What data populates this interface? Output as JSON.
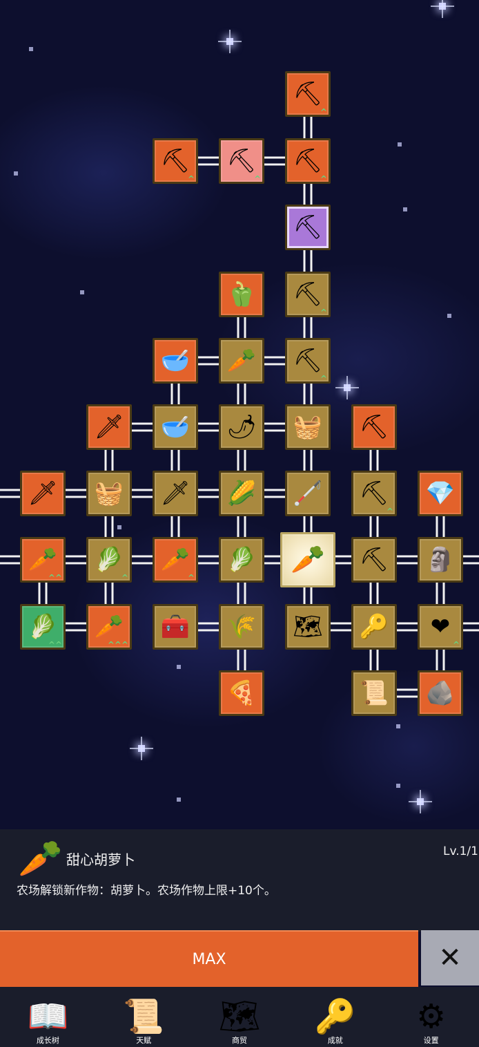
{
  "tree": {
    "nodes": [
      {
        "id": "n1",
        "color": "orange",
        "icon": "shovel-icon",
        "glyph": "⛏",
        "level_mark": "^",
        "col": 4,
        "row": 0
      },
      {
        "id": "n2",
        "color": "orange",
        "icon": "shovel-icon",
        "glyph": "⛏",
        "level_mark": "^",
        "col": 2,
        "row": 1
      },
      {
        "id": "n3",
        "color": "pink",
        "icon": "shovel-icon",
        "glyph": "⛏",
        "level_mark": "^",
        "col": 3,
        "row": 1
      },
      {
        "id": "n4",
        "color": "orange",
        "icon": "shovel-icon",
        "glyph": "⛏",
        "level_mark": "^",
        "col": 4,
        "row": 1
      },
      {
        "id": "n5",
        "color": "purple",
        "icon": "shovel-icon",
        "glyph": "⛏",
        "level_mark": "",
        "col": 4,
        "row": 2
      },
      {
        "id": "n6",
        "color": "orange",
        "icon": "pepper-icon",
        "glyph": "🫑",
        "level_mark": "",
        "col": 3,
        "row": 3
      },
      {
        "id": "n7",
        "color": "olive",
        "icon": "shovel-icon",
        "glyph": "⛏",
        "level_mark": "^",
        "col": 4,
        "row": 3
      },
      {
        "id": "n8",
        "color": "orange",
        "icon": "soup-bowl-icon",
        "glyph": "🥣",
        "level_mark": "",
        "col": 2,
        "row": 4
      },
      {
        "id": "n9",
        "color": "olive",
        "icon": "radish-icon",
        "glyph": "🥕",
        "level_mark": "",
        "col": 3,
        "row": 4
      },
      {
        "id": "n10",
        "color": "olive",
        "icon": "shovel-icon",
        "glyph": "⛏",
        "level_mark": "^",
        "col": 4,
        "row": 4
      },
      {
        "id": "n11",
        "color": "orange",
        "icon": "golden-sword-icon",
        "glyph": "🗡",
        "level_mark": "",
        "col": 1,
        "row": 5
      },
      {
        "id": "n12",
        "color": "olive",
        "icon": "bowl-icon",
        "glyph": "🥣",
        "level_mark": "",
        "col": 2,
        "row": 5
      },
      {
        "id": "n13",
        "color": "olive",
        "icon": "chili-icon",
        "glyph": "🌶",
        "level_mark": "",
        "col": 3,
        "row": 5
      },
      {
        "id": "n14",
        "color": "olive",
        "icon": "crate-icon",
        "glyph": "🧺",
        "level_mark": "",
        "col": 4,
        "row": 5
      },
      {
        "id": "n15",
        "color": "orange",
        "icon": "pickaxe-icon",
        "glyph": "⛏",
        "level_mark": "",
        "col": 5,
        "row": 5
      },
      {
        "id": "n16",
        "color": "orange",
        "icon": "sword-icon",
        "glyph": "🗡",
        "level_mark": "",
        "col": 0,
        "row": 6
      },
      {
        "id": "n17",
        "color": "olive",
        "icon": "crate-icon",
        "glyph": "🧺",
        "level_mark": "",
        "col": 1,
        "row": 6
      },
      {
        "id": "n18",
        "color": "olive",
        "icon": "sword-icon",
        "glyph": "🗡",
        "level_mark": "",
        "col": 2,
        "row": 6
      },
      {
        "id": "n19",
        "color": "olive",
        "icon": "corn-icon",
        "glyph": "🌽",
        "level_mark": "",
        "col": 3,
        "row": 6
      },
      {
        "id": "n20",
        "color": "olive",
        "icon": "staff-icon",
        "glyph": "🦯",
        "level_mark": "",
        "col": 4,
        "row": 6
      },
      {
        "id": "n21",
        "color": "olive",
        "icon": "pickaxe-icon",
        "glyph": "⛏",
        "level_mark": "^",
        "col": 5,
        "row": 6
      },
      {
        "id": "n22",
        "color": "orange",
        "icon": "crystal-icon",
        "glyph": "💎",
        "level_mark": "",
        "col": 6,
        "row": 6
      },
      {
        "id": "n23",
        "color": "orange",
        "icon": "carrot-icon",
        "glyph": "🥕",
        "level_mark": "^^",
        "col": 0,
        "row": 7
      },
      {
        "id": "n24",
        "color": "olive",
        "icon": "cabbage-icon",
        "glyph": "🥬",
        "level_mark": "^",
        "col": 1,
        "row": 7
      },
      {
        "id": "n25",
        "color": "orange",
        "icon": "carrot-icon",
        "glyph": "🥕",
        "level_mark": "^",
        "col": 2,
        "row": 7
      },
      {
        "id": "n26",
        "color": "olive",
        "icon": "cabbage-icon",
        "glyph": "🥬",
        "level_mark": "",
        "col": 3,
        "row": 7
      },
      {
        "id": "n27",
        "color": "selected",
        "icon": "carrot-icon",
        "glyph": "🥕",
        "level_mark": "",
        "col": 4,
        "row": 7
      },
      {
        "id": "n28",
        "color": "olive",
        "icon": "pickaxe-icon",
        "glyph": "⛏",
        "level_mark": "",
        "col": 5,
        "row": 7
      },
      {
        "id": "n29",
        "color": "olive",
        "icon": "statue-icon",
        "glyph": "🗿",
        "level_mark": "",
        "col": 6,
        "row": 7
      },
      {
        "id": "n30",
        "color": "green",
        "icon": "cabbage-icon",
        "glyph": "🥬",
        "level_mark": "^^",
        "col": 0,
        "row": 8
      },
      {
        "id": "n31",
        "color": "orange",
        "icon": "carrot-icon",
        "glyph": "🥕",
        "level_mark": "^^^",
        "col": 1,
        "row": 8
      },
      {
        "id": "n32",
        "color": "olive",
        "icon": "chest-icon",
        "glyph": "🧰",
        "level_mark": "",
        "col": 2,
        "row": 8
      },
      {
        "id": "n33",
        "color": "olive",
        "icon": "wheat-icon",
        "glyph": "🌾",
        "level_mark": "",
        "col": 3,
        "row": 8
      },
      {
        "id": "n34",
        "color": "olive",
        "icon": "map-icon",
        "glyph": "🗺",
        "level_mark": "",
        "col": 4,
        "row": 8
      },
      {
        "id": "n35",
        "color": "olive",
        "icon": "key-icon",
        "glyph": "🔑",
        "level_mark": "",
        "col": 5,
        "row": 8
      },
      {
        "id": "n36",
        "color": "olive",
        "icon": "heart-icon",
        "glyph": "❤",
        "level_mark": "^",
        "col": 6,
        "row": 8
      },
      {
        "id": "n37",
        "color": "orange",
        "icon": "pizza-icon",
        "glyph": "🍕",
        "level_mark": "",
        "col": 3,
        "row": 9
      },
      {
        "id": "n38",
        "color": "olive",
        "icon": "scroll-icon",
        "glyph": "📜",
        "level_mark": "",
        "col": 5,
        "row": 9
      },
      {
        "id": "n39",
        "color": "orange",
        "icon": "stone-icon",
        "glyph": "🪨",
        "level_mark": "",
        "col": 6,
        "row": 9
      }
    ],
    "links": [
      [
        "n1",
        "n4"
      ],
      [
        "n2",
        "n3"
      ],
      [
        "n3",
        "n4"
      ],
      [
        "n4",
        "n5"
      ],
      [
        "n5",
        "n7"
      ],
      [
        "n6",
        "n9"
      ],
      [
        "n7",
        "n10"
      ],
      [
        "n8",
        "n9"
      ],
      [
        "n9",
        "n10"
      ],
      [
        "n8",
        "n12"
      ],
      [
        "n9",
        "n13"
      ],
      [
        "n10",
        "n14"
      ],
      [
        "n11",
        "n12"
      ],
      [
        "n12",
        "n13"
      ],
      [
        "n13",
        "n14"
      ],
      [
        "n11",
        "n17"
      ],
      [
        "n12",
        "n18"
      ],
      [
        "n13",
        "n19"
      ],
      [
        "n14",
        "n20"
      ],
      [
        "n15",
        "n21"
      ],
      [
        "n16",
        "n17"
      ],
      [
        "n17",
        "n18"
      ],
      [
        "n18",
        "n19"
      ],
      [
        "n19",
        "n20"
      ],
      [
        "n17",
        "n24"
      ],
      [
        "n18",
        "n25"
      ],
      [
        "n19",
        "n26"
      ],
      [
        "n20",
        "n27"
      ],
      [
        "n21",
        "n28"
      ],
      [
        "n22",
        "n29"
      ],
      [
        "n23",
        "n24"
      ],
      [
        "n24",
        "n25"
      ],
      [
        "n25",
        "n26"
      ],
      [
        "n26",
        "n27"
      ],
      [
        "n27",
        "n28"
      ],
      [
        "n28",
        "n29"
      ],
      [
        "n23",
        "n30"
      ],
      [
        "n24",
        "n31"
      ],
      [
        "n26",
        "n33"
      ],
      [
        "n27",
        "n34"
      ],
      [
        "n28",
        "n35"
      ],
      [
        "n29",
        "n36"
      ],
      [
        "n30",
        "n31"
      ],
      [
        "n32",
        "n33"
      ],
      [
        "n34",
        "n35"
      ],
      [
        "n35",
        "n36"
      ],
      [
        "n33",
        "n37"
      ],
      [
        "n35",
        "n38"
      ],
      [
        "n38",
        "n39"
      ],
      [
        "n36",
        "n39"
      ]
    ]
  },
  "selected_item": {
    "icon": "carrot-icon",
    "glyph": "🥕",
    "name": "甜心胡萝卜",
    "level": "Lv.1/1",
    "description": "农场解锁新作物：胡萝卜。农场作物上限+10个。"
  },
  "actions": {
    "max_label": "MAX",
    "close_icon": "close-icon"
  },
  "nav": [
    {
      "label": "成长树",
      "icon": "book-icon",
      "glyph": "📖"
    },
    {
      "label": "天赋",
      "icon": "scroll-icon",
      "glyph": "📜"
    },
    {
      "label": "商贸",
      "icon": "map-icon",
      "glyph": "🗺"
    },
    {
      "label": "成就",
      "icon": "key-icon",
      "glyph": "🔑"
    },
    {
      "label": "设置",
      "icon": "gear-icon",
      "glyph": "⚙"
    }
  ]
}
